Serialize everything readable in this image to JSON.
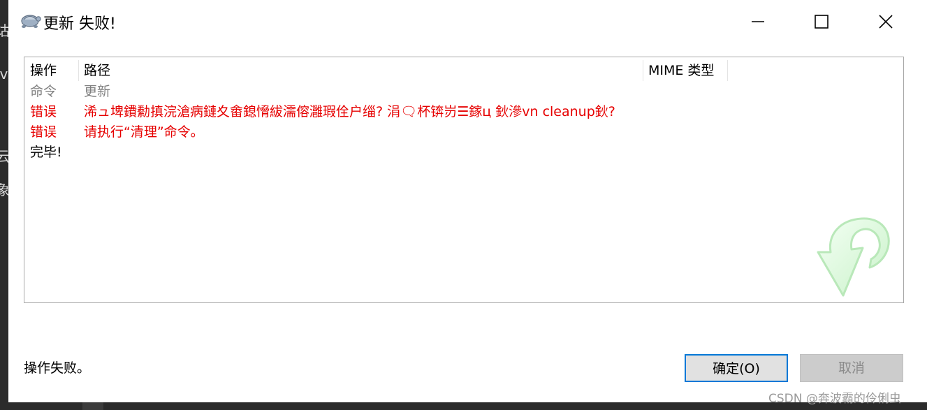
{
  "background": {
    "edge_chars": [
      "诂",
      "iv",
      "云",
      "象"
    ]
  },
  "window": {
    "title": "更新 失败!",
    "controls": {
      "minimize": "minimize",
      "maximize": "maximize",
      "close": "close"
    }
  },
  "list": {
    "columns": [
      "操作",
      "路径",
      "MIME 类型"
    ],
    "rows": [
      {
        "action": "命令",
        "path": "更新",
        "style": "gray"
      },
      {
        "action": "错误",
        "path": "浠ュ埤鐨勬搷浣滄病鏈夊畬鎴愶紱濡傛灉瑕佺户缁?  涓🗨杯锛岃☰鎵ц  鈥滲vn cleanup鈥?",
        "style": "red"
      },
      {
        "action": "错误",
        "path": "请执行“清理”命令。",
        "style": "red"
      },
      {
        "action": "完毕!",
        "path": "",
        "style": "black"
      }
    ]
  },
  "footer": {
    "status": "操作失败。",
    "ok_label": "确定(O)",
    "cancel_label": "取消"
  },
  "watermark": "CSDN @奔波霸的伶俐虫",
  "colors": {
    "error": "#e60000",
    "muted": "#808080",
    "focus_border": "#0078d7"
  }
}
